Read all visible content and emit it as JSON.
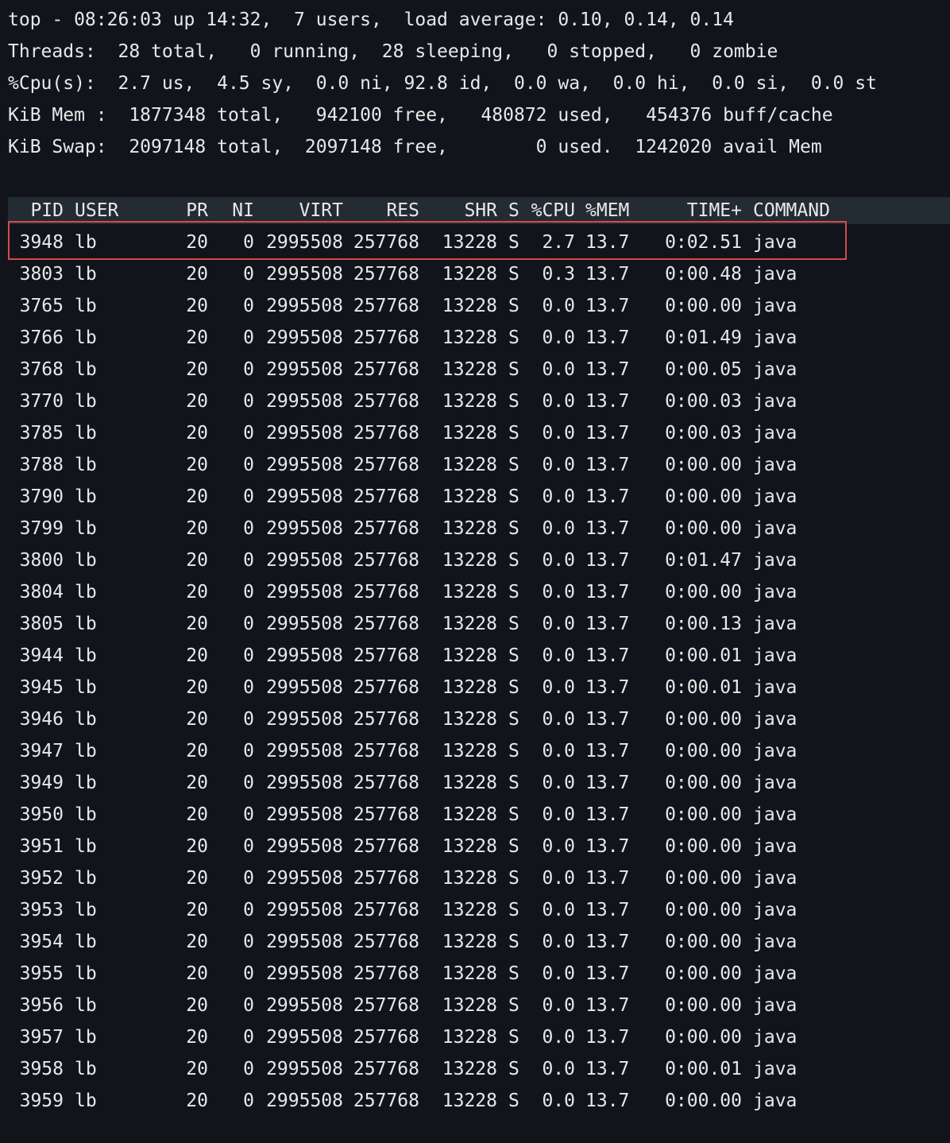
{
  "summary": {
    "line1": "top - 08:26:03 up 14:32,  7 users,  load average: 0.10, 0.14, 0.14",
    "line2": "Threads:  28 total,   0 running,  28 sleeping,   0 stopped,   0 zombie",
    "line3": "%Cpu(s):  2.7 us,  4.5 sy,  0.0 ni, 92.8 id,  0.0 wa,  0.0 hi,  0.0 si,  0.0 st",
    "line4": "KiB Mem :  1877348 total,   942100 free,   480872 used,   454376 buff/cache",
    "line5": "KiB Swap:  2097148 total,  2097148 free,        0 used.  1242020 avail Mem"
  },
  "columns": {
    "pid": "PID",
    "user": "USER",
    "pr": "PR",
    "ni": "NI",
    "virt": "VIRT",
    "res": "RES",
    "shr": "SHR",
    "s": "S",
    "cpu": "%CPU",
    "mem": "%MEM",
    "time": "TIME+",
    "command": "COMMAND"
  },
  "highlighted_row_index": 0,
  "colors": {
    "background": "#11151b",
    "text": "#e8e8e8",
    "header_bar": "#232b33",
    "highlight_border": "#d64a4a"
  },
  "rows": [
    {
      "pid": "3948",
      "user": "lb",
      "pr": "20",
      "ni": "0",
      "virt": "2995508",
      "res": "257768",
      "shr": "13228",
      "s": "S",
      "cpu": "2.7",
      "mem": "13.7",
      "time": "0:02.51",
      "command": "java"
    },
    {
      "pid": "3803",
      "user": "lb",
      "pr": "20",
      "ni": "0",
      "virt": "2995508",
      "res": "257768",
      "shr": "13228",
      "s": "S",
      "cpu": "0.3",
      "mem": "13.7",
      "time": "0:00.48",
      "command": "java"
    },
    {
      "pid": "3765",
      "user": "lb",
      "pr": "20",
      "ni": "0",
      "virt": "2995508",
      "res": "257768",
      "shr": "13228",
      "s": "S",
      "cpu": "0.0",
      "mem": "13.7",
      "time": "0:00.00",
      "command": "java"
    },
    {
      "pid": "3766",
      "user": "lb",
      "pr": "20",
      "ni": "0",
      "virt": "2995508",
      "res": "257768",
      "shr": "13228",
      "s": "S",
      "cpu": "0.0",
      "mem": "13.7",
      "time": "0:01.49",
      "command": "java"
    },
    {
      "pid": "3768",
      "user": "lb",
      "pr": "20",
      "ni": "0",
      "virt": "2995508",
      "res": "257768",
      "shr": "13228",
      "s": "S",
      "cpu": "0.0",
      "mem": "13.7",
      "time": "0:00.05",
      "command": "java"
    },
    {
      "pid": "3770",
      "user": "lb",
      "pr": "20",
      "ni": "0",
      "virt": "2995508",
      "res": "257768",
      "shr": "13228",
      "s": "S",
      "cpu": "0.0",
      "mem": "13.7",
      "time": "0:00.03",
      "command": "java"
    },
    {
      "pid": "3785",
      "user": "lb",
      "pr": "20",
      "ni": "0",
      "virt": "2995508",
      "res": "257768",
      "shr": "13228",
      "s": "S",
      "cpu": "0.0",
      "mem": "13.7",
      "time": "0:00.03",
      "command": "java"
    },
    {
      "pid": "3788",
      "user": "lb",
      "pr": "20",
      "ni": "0",
      "virt": "2995508",
      "res": "257768",
      "shr": "13228",
      "s": "S",
      "cpu": "0.0",
      "mem": "13.7",
      "time": "0:00.00",
      "command": "java"
    },
    {
      "pid": "3790",
      "user": "lb",
      "pr": "20",
      "ni": "0",
      "virt": "2995508",
      "res": "257768",
      "shr": "13228",
      "s": "S",
      "cpu": "0.0",
      "mem": "13.7",
      "time": "0:00.00",
      "command": "java"
    },
    {
      "pid": "3799",
      "user": "lb",
      "pr": "20",
      "ni": "0",
      "virt": "2995508",
      "res": "257768",
      "shr": "13228",
      "s": "S",
      "cpu": "0.0",
      "mem": "13.7",
      "time": "0:00.00",
      "command": "java"
    },
    {
      "pid": "3800",
      "user": "lb",
      "pr": "20",
      "ni": "0",
      "virt": "2995508",
      "res": "257768",
      "shr": "13228",
      "s": "S",
      "cpu": "0.0",
      "mem": "13.7",
      "time": "0:01.47",
      "command": "java"
    },
    {
      "pid": "3804",
      "user": "lb",
      "pr": "20",
      "ni": "0",
      "virt": "2995508",
      "res": "257768",
      "shr": "13228",
      "s": "S",
      "cpu": "0.0",
      "mem": "13.7",
      "time": "0:00.00",
      "command": "java"
    },
    {
      "pid": "3805",
      "user": "lb",
      "pr": "20",
      "ni": "0",
      "virt": "2995508",
      "res": "257768",
      "shr": "13228",
      "s": "S",
      "cpu": "0.0",
      "mem": "13.7",
      "time": "0:00.13",
      "command": "java"
    },
    {
      "pid": "3944",
      "user": "lb",
      "pr": "20",
      "ni": "0",
      "virt": "2995508",
      "res": "257768",
      "shr": "13228",
      "s": "S",
      "cpu": "0.0",
      "mem": "13.7",
      "time": "0:00.01",
      "command": "java"
    },
    {
      "pid": "3945",
      "user": "lb",
      "pr": "20",
      "ni": "0",
      "virt": "2995508",
      "res": "257768",
      "shr": "13228",
      "s": "S",
      "cpu": "0.0",
      "mem": "13.7",
      "time": "0:00.01",
      "command": "java"
    },
    {
      "pid": "3946",
      "user": "lb",
      "pr": "20",
      "ni": "0",
      "virt": "2995508",
      "res": "257768",
      "shr": "13228",
      "s": "S",
      "cpu": "0.0",
      "mem": "13.7",
      "time": "0:00.00",
      "command": "java"
    },
    {
      "pid": "3947",
      "user": "lb",
      "pr": "20",
      "ni": "0",
      "virt": "2995508",
      "res": "257768",
      "shr": "13228",
      "s": "S",
      "cpu": "0.0",
      "mem": "13.7",
      "time": "0:00.00",
      "command": "java"
    },
    {
      "pid": "3949",
      "user": "lb",
      "pr": "20",
      "ni": "0",
      "virt": "2995508",
      "res": "257768",
      "shr": "13228",
      "s": "S",
      "cpu": "0.0",
      "mem": "13.7",
      "time": "0:00.00",
      "command": "java"
    },
    {
      "pid": "3950",
      "user": "lb",
      "pr": "20",
      "ni": "0",
      "virt": "2995508",
      "res": "257768",
      "shr": "13228",
      "s": "S",
      "cpu": "0.0",
      "mem": "13.7",
      "time": "0:00.00",
      "command": "java"
    },
    {
      "pid": "3951",
      "user": "lb",
      "pr": "20",
      "ni": "0",
      "virt": "2995508",
      "res": "257768",
      "shr": "13228",
      "s": "S",
      "cpu": "0.0",
      "mem": "13.7",
      "time": "0:00.00",
      "command": "java"
    },
    {
      "pid": "3952",
      "user": "lb",
      "pr": "20",
      "ni": "0",
      "virt": "2995508",
      "res": "257768",
      "shr": "13228",
      "s": "S",
      "cpu": "0.0",
      "mem": "13.7",
      "time": "0:00.00",
      "command": "java"
    },
    {
      "pid": "3953",
      "user": "lb",
      "pr": "20",
      "ni": "0",
      "virt": "2995508",
      "res": "257768",
      "shr": "13228",
      "s": "S",
      "cpu": "0.0",
      "mem": "13.7",
      "time": "0:00.00",
      "command": "java"
    },
    {
      "pid": "3954",
      "user": "lb",
      "pr": "20",
      "ni": "0",
      "virt": "2995508",
      "res": "257768",
      "shr": "13228",
      "s": "S",
      "cpu": "0.0",
      "mem": "13.7",
      "time": "0:00.00",
      "command": "java"
    },
    {
      "pid": "3955",
      "user": "lb",
      "pr": "20",
      "ni": "0",
      "virt": "2995508",
      "res": "257768",
      "shr": "13228",
      "s": "S",
      "cpu": "0.0",
      "mem": "13.7",
      "time": "0:00.00",
      "command": "java"
    },
    {
      "pid": "3956",
      "user": "lb",
      "pr": "20",
      "ni": "0",
      "virt": "2995508",
      "res": "257768",
      "shr": "13228",
      "s": "S",
      "cpu": "0.0",
      "mem": "13.7",
      "time": "0:00.00",
      "command": "java"
    },
    {
      "pid": "3957",
      "user": "lb",
      "pr": "20",
      "ni": "0",
      "virt": "2995508",
      "res": "257768",
      "shr": "13228",
      "s": "S",
      "cpu": "0.0",
      "mem": "13.7",
      "time": "0:00.00",
      "command": "java"
    },
    {
      "pid": "3958",
      "user": "lb",
      "pr": "20",
      "ni": "0",
      "virt": "2995508",
      "res": "257768",
      "shr": "13228",
      "s": "S",
      "cpu": "0.0",
      "mem": "13.7",
      "time": "0:00.01",
      "command": "java"
    },
    {
      "pid": "3959",
      "user": "lb",
      "pr": "20",
      "ni": "0",
      "virt": "2995508",
      "res": "257768",
      "shr": "13228",
      "s": "S",
      "cpu": "0.0",
      "mem": "13.7",
      "time": "0:00.00",
      "command": "java"
    }
  ]
}
